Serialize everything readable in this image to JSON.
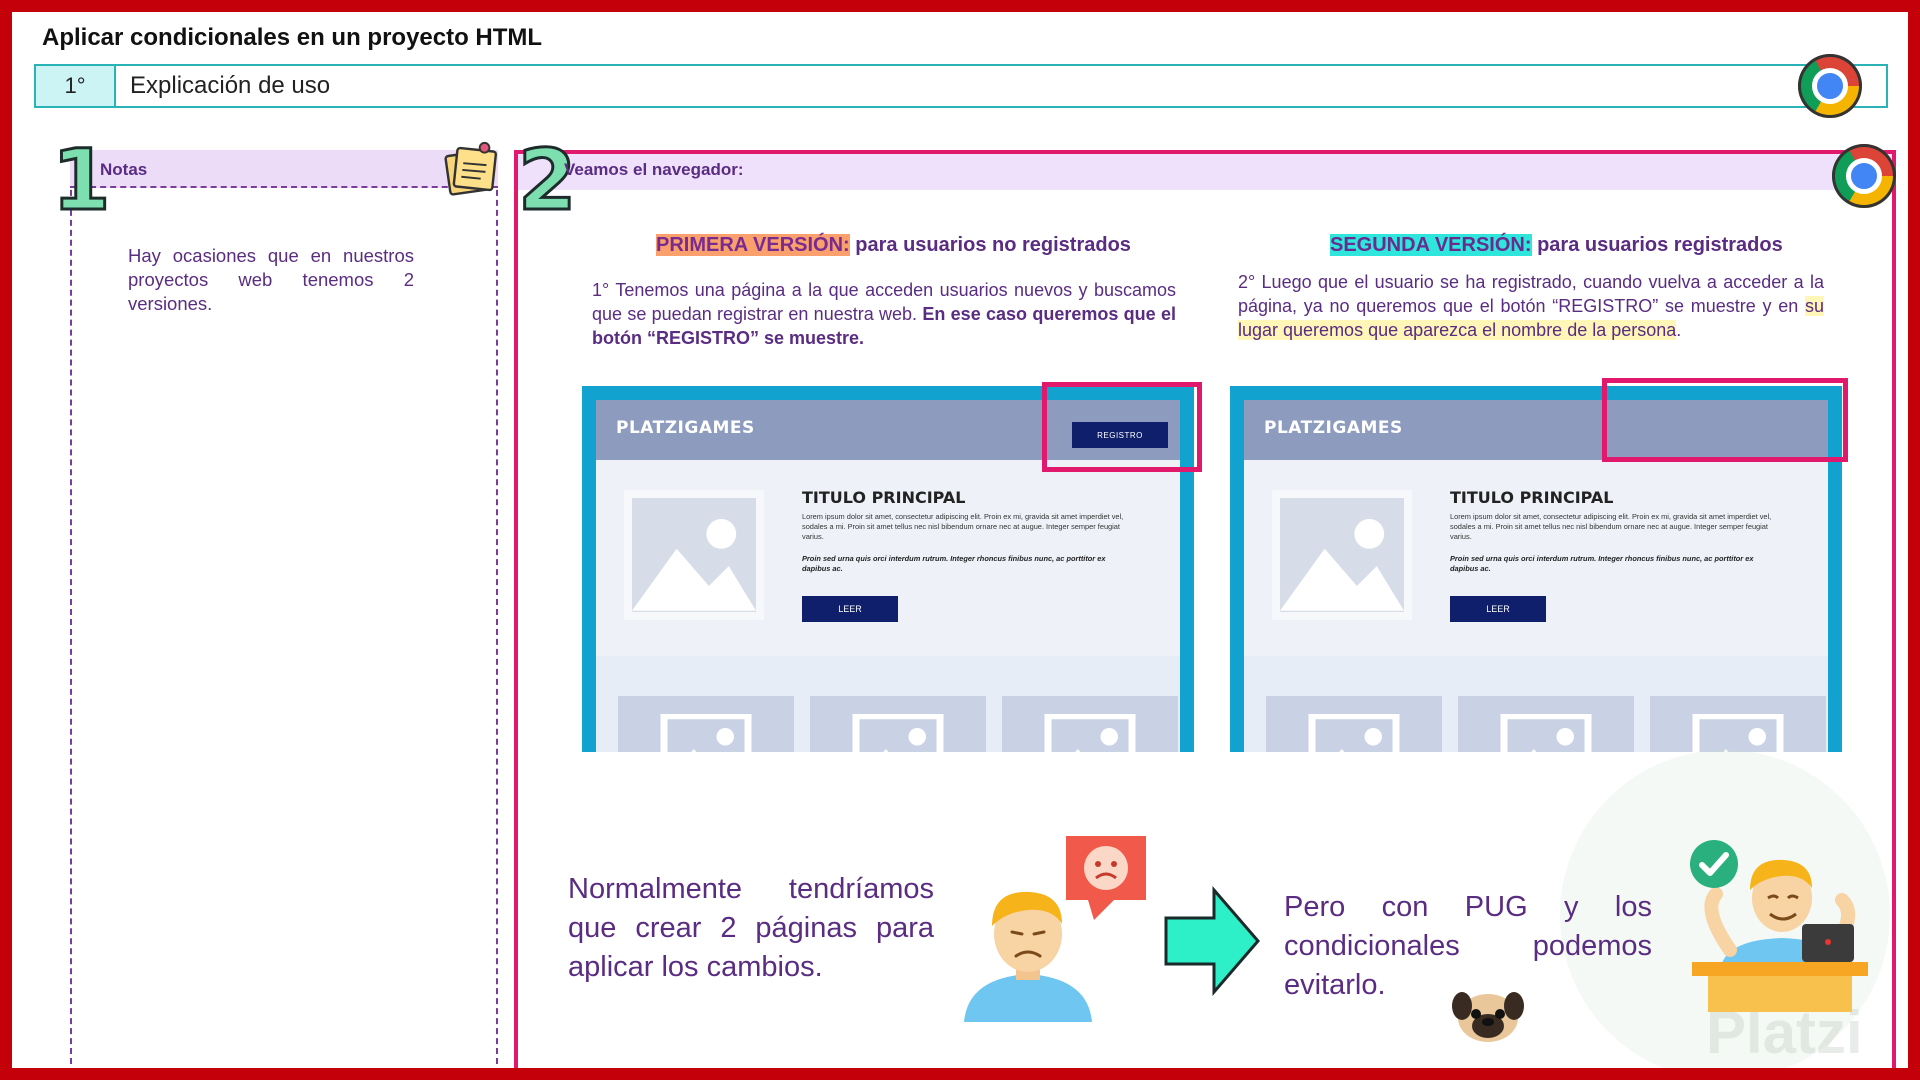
{
  "slide": {
    "title": "Aplicar condicionales en un proyecto HTML",
    "step_number": "1°",
    "step_label": "Explicación de uso"
  },
  "notes": {
    "number": "1",
    "title": "Notas",
    "body": "Hay ocasiones que en nuestros proyectos web tenemos 2 versiones."
  },
  "browser": {
    "number": "2",
    "title": "Veamos el navegador:",
    "first": {
      "tag": "PRIMERA VERSIÓN:",
      "subtitle": " para usuarios no registrados",
      "desc_plain": "1° Tenemos una página a la que acceden usuarios nuevos y buscamos que se puedan registrar en nuestra web. ",
      "desc_bold": "En ese caso queremos que el botón “REGISTRO” se muestre."
    },
    "second": {
      "tag": "SEGUNDA VERSIÓN:",
      "subtitle": " para usuarios registrados",
      "desc_plain": "2° Luego que el usuario se ha registrado, cuando vuelva a acceder a la página, ya no queremos que el botón “REGISTRO” se muestre y en ",
      "desc_highlight": "su lugar queremos que aparezca el nombre de la persona",
      "desc_end": "."
    },
    "mockup": {
      "brand": "PLATZIGAMES",
      "register_button": "REGISTRO",
      "heading": "TITULO PRINCIPAL",
      "lorem": "Lorem ipsum dolor sit amet, consectetur adipiscing elit. Proin ex mi, gravida sit amet imperdiet vel, sodales a mi. Proin sit amet tellus nec nisl bibendum ornare nec at augue. Integer semper feugiat varius.",
      "lorem_bold": "Proin sed urna quis orci interdum rutrum. Integer rhoncus finibus nunc, ac porttitor ex dapibus ac.",
      "read_button": "LEER"
    },
    "bottom_left": "Normalmente tendríamos que crear 2 páginas para aplicar los cambios.",
    "bottom_right": "Pero con PUG y los condicionales podemos evitarlo."
  },
  "colors": {
    "frame": "#c4000b",
    "accent_pink": "#e0196d",
    "text_purple": "#5a2c82",
    "teal": "#2ab3b7"
  },
  "icons": [
    "chrome-icon",
    "notepad-icon",
    "sad-person-icon",
    "sad-speech-bubble-icon",
    "arrow-right-icon",
    "happy-person-icon",
    "check-icon",
    "pug-icon"
  ],
  "watermark": "Platzi"
}
